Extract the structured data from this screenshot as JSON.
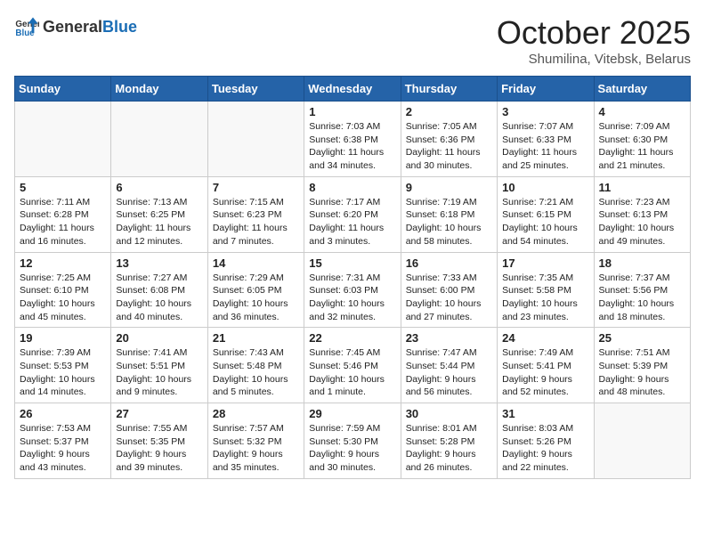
{
  "header": {
    "logo_general": "General",
    "logo_blue": "Blue",
    "month_title": "October 2025",
    "subtitle": "Shumilina, Vitebsk, Belarus"
  },
  "days_of_week": [
    "Sunday",
    "Monday",
    "Tuesday",
    "Wednesday",
    "Thursday",
    "Friday",
    "Saturday"
  ],
  "weeks": [
    [
      {
        "day": "",
        "content": ""
      },
      {
        "day": "",
        "content": ""
      },
      {
        "day": "",
        "content": ""
      },
      {
        "day": "1",
        "content": "Sunrise: 7:03 AM\nSunset: 6:38 PM\nDaylight: 11 hours and 34 minutes."
      },
      {
        "day": "2",
        "content": "Sunrise: 7:05 AM\nSunset: 6:36 PM\nDaylight: 11 hours and 30 minutes."
      },
      {
        "day": "3",
        "content": "Sunrise: 7:07 AM\nSunset: 6:33 PM\nDaylight: 11 hours and 25 minutes."
      },
      {
        "day": "4",
        "content": "Sunrise: 7:09 AM\nSunset: 6:30 PM\nDaylight: 11 hours and 21 minutes."
      }
    ],
    [
      {
        "day": "5",
        "content": "Sunrise: 7:11 AM\nSunset: 6:28 PM\nDaylight: 11 hours and 16 minutes."
      },
      {
        "day": "6",
        "content": "Sunrise: 7:13 AM\nSunset: 6:25 PM\nDaylight: 11 hours and 12 minutes."
      },
      {
        "day": "7",
        "content": "Sunrise: 7:15 AM\nSunset: 6:23 PM\nDaylight: 11 hours and 7 minutes."
      },
      {
        "day": "8",
        "content": "Sunrise: 7:17 AM\nSunset: 6:20 PM\nDaylight: 11 hours and 3 minutes."
      },
      {
        "day": "9",
        "content": "Sunrise: 7:19 AM\nSunset: 6:18 PM\nDaylight: 10 hours and 58 minutes."
      },
      {
        "day": "10",
        "content": "Sunrise: 7:21 AM\nSunset: 6:15 PM\nDaylight: 10 hours and 54 minutes."
      },
      {
        "day": "11",
        "content": "Sunrise: 7:23 AM\nSunset: 6:13 PM\nDaylight: 10 hours and 49 minutes."
      }
    ],
    [
      {
        "day": "12",
        "content": "Sunrise: 7:25 AM\nSunset: 6:10 PM\nDaylight: 10 hours and 45 minutes."
      },
      {
        "day": "13",
        "content": "Sunrise: 7:27 AM\nSunset: 6:08 PM\nDaylight: 10 hours and 40 minutes."
      },
      {
        "day": "14",
        "content": "Sunrise: 7:29 AM\nSunset: 6:05 PM\nDaylight: 10 hours and 36 minutes."
      },
      {
        "day": "15",
        "content": "Sunrise: 7:31 AM\nSunset: 6:03 PM\nDaylight: 10 hours and 32 minutes."
      },
      {
        "day": "16",
        "content": "Sunrise: 7:33 AM\nSunset: 6:00 PM\nDaylight: 10 hours and 27 minutes."
      },
      {
        "day": "17",
        "content": "Sunrise: 7:35 AM\nSunset: 5:58 PM\nDaylight: 10 hours and 23 minutes."
      },
      {
        "day": "18",
        "content": "Sunrise: 7:37 AM\nSunset: 5:56 PM\nDaylight: 10 hours and 18 minutes."
      }
    ],
    [
      {
        "day": "19",
        "content": "Sunrise: 7:39 AM\nSunset: 5:53 PM\nDaylight: 10 hours and 14 minutes."
      },
      {
        "day": "20",
        "content": "Sunrise: 7:41 AM\nSunset: 5:51 PM\nDaylight: 10 hours and 9 minutes."
      },
      {
        "day": "21",
        "content": "Sunrise: 7:43 AM\nSunset: 5:48 PM\nDaylight: 10 hours and 5 minutes."
      },
      {
        "day": "22",
        "content": "Sunrise: 7:45 AM\nSunset: 5:46 PM\nDaylight: 10 hours and 1 minute."
      },
      {
        "day": "23",
        "content": "Sunrise: 7:47 AM\nSunset: 5:44 PM\nDaylight: 9 hours and 56 minutes."
      },
      {
        "day": "24",
        "content": "Sunrise: 7:49 AM\nSunset: 5:41 PM\nDaylight: 9 hours and 52 minutes."
      },
      {
        "day": "25",
        "content": "Sunrise: 7:51 AM\nSunset: 5:39 PM\nDaylight: 9 hours and 48 minutes."
      }
    ],
    [
      {
        "day": "26",
        "content": "Sunrise: 7:53 AM\nSunset: 5:37 PM\nDaylight: 9 hours and 43 minutes."
      },
      {
        "day": "27",
        "content": "Sunrise: 7:55 AM\nSunset: 5:35 PM\nDaylight: 9 hours and 39 minutes."
      },
      {
        "day": "28",
        "content": "Sunrise: 7:57 AM\nSunset: 5:32 PM\nDaylight: 9 hours and 35 minutes."
      },
      {
        "day": "29",
        "content": "Sunrise: 7:59 AM\nSunset: 5:30 PM\nDaylight: 9 hours and 30 minutes."
      },
      {
        "day": "30",
        "content": "Sunrise: 8:01 AM\nSunset: 5:28 PM\nDaylight: 9 hours and 26 minutes."
      },
      {
        "day": "31",
        "content": "Sunrise: 8:03 AM\nSunset: 5:26 PM\nDaylight: 9 hours and 22 minutes."
      },
      {
        "day": "",
        "content": ""
      }
    ]
  ]
}
